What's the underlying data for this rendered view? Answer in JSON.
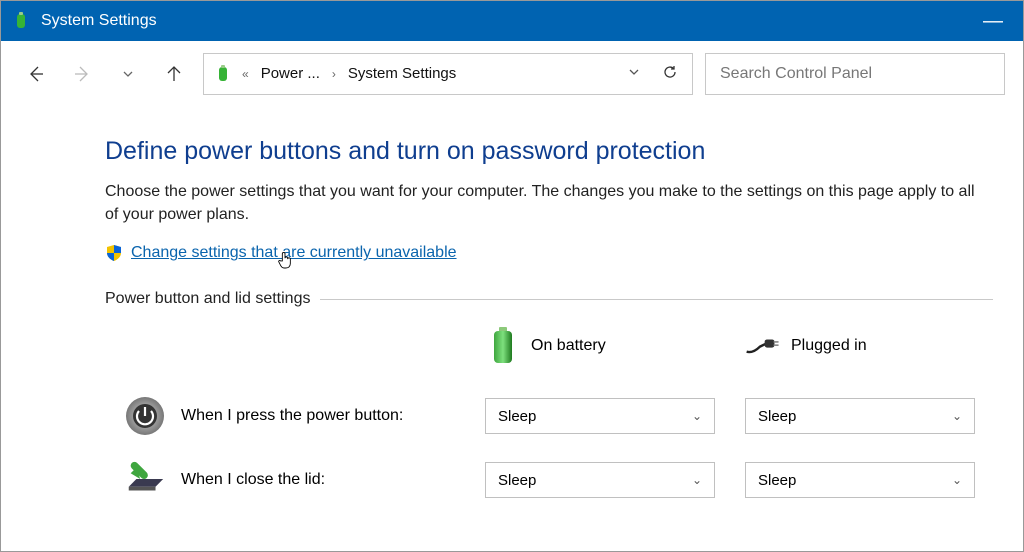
{
  "titlebar": {
    "title": "System Settings"
  },
  "breadcrumb": {
    "item1": "Power ...",
    "item2": "System Settings"
  },
  "search": {
    "placeholder": "Search Control Panel"
  },
  "heading": "Define power buttons and turn on password protection",
  "description": "Choose the power settings that you want for your computer. The changes you make to the settings on this page apply to all of your power plans.",
  "change_link": "Change settings that are currently unavailable",
  "section_label": "Power button and lid settings",
  "columns": {
    "battery": "On battery",
    "plugged": "Plugged in"
  },
  "rows": {
    "power_button": {
      "label": "When I press the power button:",
      "battery_value": "Sleep",
      "plugged_value": "Sleep"
    },
    "close_lid": {
      "label": "When I close the lid:",
      "battery_value": "Sleep",
      "plugged_value": "Sleep"
    }
  }
}
